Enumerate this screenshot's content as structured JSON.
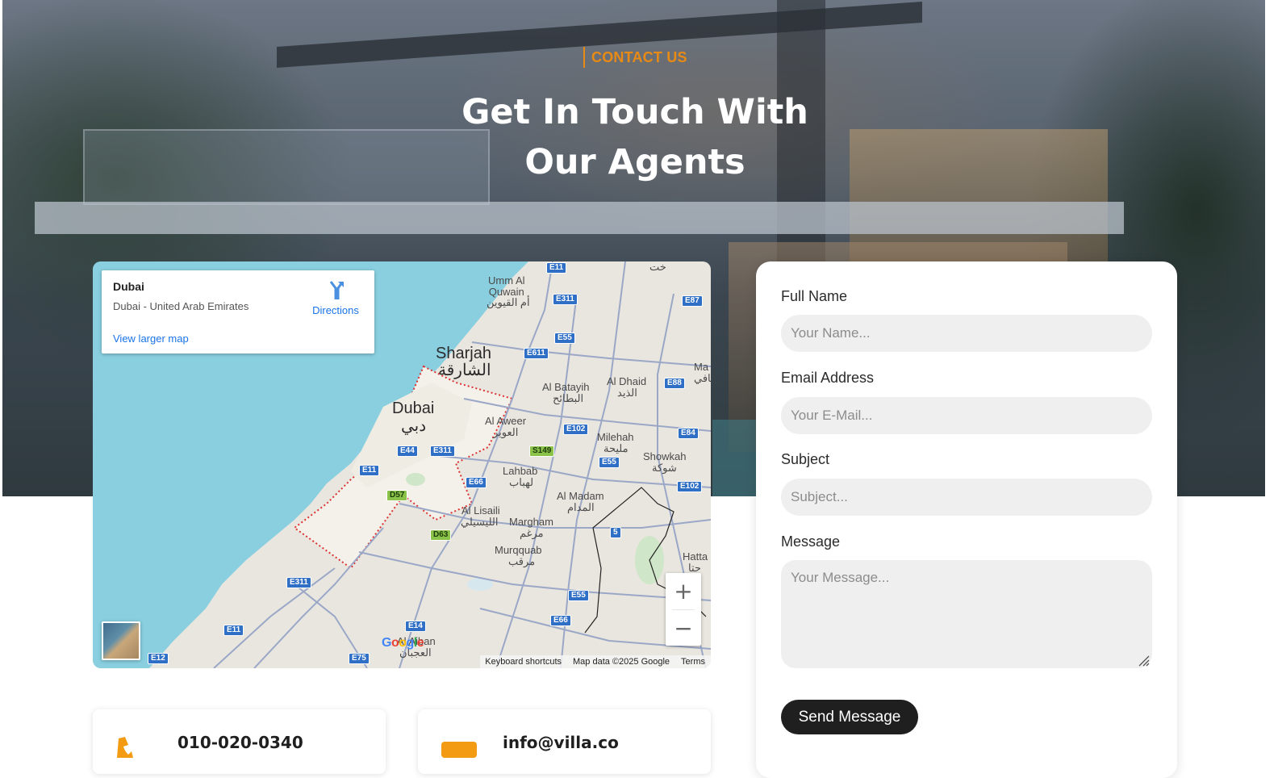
{
  "hero": {
    "eyebrow": "CONTACT US",
    "title_line1": "Get In Touch With",
    "title_line2": "Our Agents"
  },
  "map": {
    "place_name": "Dubai",
    "place_address": "Dubai - United Arab Emirates",
    "directions_label": "Directions",
    "view_larger_label": "View larger map",
    "zoom_in": "+",
    "zoom_out": "−",
    "attribution": {
      "shortcuts": "Keyboard shortcuts",
      "data": "Map data ©2025 Google",
      "terms": "Terms"
    },
    "logo": [
      "G",
      "o",
      "o",
      "g",
      "l",
      "e"
    ],
    "labels": {
      "sharjah": "Sharjah",
      "sharjah_ar": "الشارقة",
      "dubai": "Dubai",
      "dubai_ar": "دبي",
      "umm_al_quwain": "Umm Al\nQuwain",
      "umm_al_quwain_ar": "أم القيوين",
      "al_batayih": "Al Batayih",
      "al_batayih_ar": "البطائح",
      "al_dhaid": "Al Dhaid",
      "al_dhaid_ar": "الذيد",
      "al_aweer": "Al Aweer",
      "al_aweer_ar": "العوير",
      "milehah": "Milehah",
      "milehah_ar": "مليحة",
      "showkah": "Showkah",
      "showkah_ar": "شوكة",
      "lahbab": "Lahbab",
      "lahbab_ar": "لهباب",
      "al_madam": "Al Madam",
      "al_madam_ar": "المدام",
      "al_lisaili": "Al Lisaili",
      "al_lisaili_ar": "الليسيلي",
      "margham": "Margham",
      "margham_ar": "مرغم",
      "murqquab": "Murqquab",
      "murqquab_ar": "مرقب",
      "hatta": "Hatta",
      "hatta_ar": "حتا",
      "al_aiban": "Al Aiban",
      "al_aiban_ar": "العجبان",
      "ma_edge": "Ma",
      "ma_edge_ar": "مافي",
      "top_edge": "خت"
    },
    "shields": {
      "e11_top": "E11",
      "e311_top": "E311",
      "e87": "E87",
      "e55_top": "E55",
      "e611": "E611",
      "e88": "E88",
      "e102": "E102",
      "e84": "E84",
      "s149": "S149",
      "e44": "E44",
      "e311_mid": "E311",
      "e11_mid": "E11",
      "e55_mid": "E55",
      "e66_mid": "E66",
      "d57": "D57",
      "e102_b": "E102",
      "d63": "D63",
      "r5": "5",
      "e311_low": "E311",
      "e55_low": "E55",
      "e11_low": "E11",
      "e66_low": "E66",
      "e14": "E14",
      "e12": "E12",
      "e75": "E75"
    }
  },
  "form": {
    "full_name_label": "Full Name",
    "full_name_placeholder": "Your Name...",
    "email_label": "Email Address",
    "email_placeholder": "Your E-Mail...",
    "subject_label": "Subject",
    "subject_placeholder": "Subject...",
    "message_label": "Message",
    "message_placeholder": "Your Message...",
    "send_label": "Send Message"
  },
  "contacts": {
    "phone": "010-020-0340",
    "email": "info@villa.co"
  },
  "colors": {
    "accent": "#e88a14",
    "button": "#1f1f1f",
    "field_bg": "#efefef",
    "water": "#89cfe0",
    "land": "#e9e6df",
    "icon_orange": "#f39b12"
  }
}
